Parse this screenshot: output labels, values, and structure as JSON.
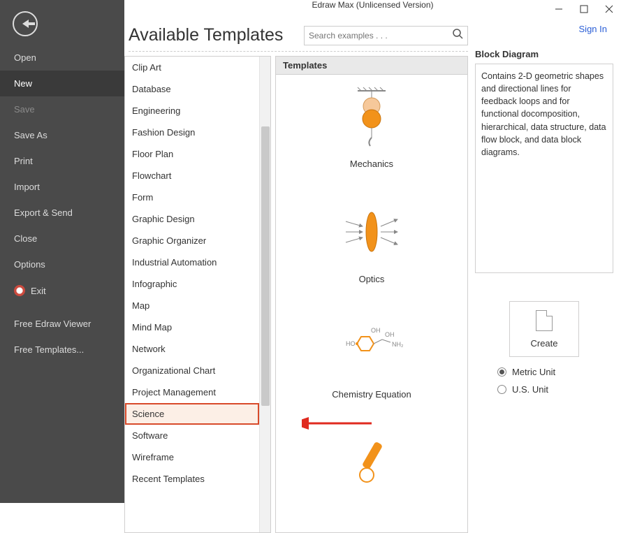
{
  "window": {
    "title": "Edraw Max (Unlicensed Version)"
  },
  "signin": "Sign In",
  "sidebar": {
    "items": [
      {
        "label": "Open",
        "state": "normal"
      },
      {
        "label": "New",
        "state": "active"
      },
      {
        "label": "Save",
        "state": "disabled"
      },
      {
        "label": "Save As",
        "state": "normal"
      },
      {
        "label": "Print",
        "state": "normal"
      },
      {
        "label": "Import",
        "state": "normal"
      },
      {
        "label": "Export & Send",
        "state": "normal"
      },
      {
        "label": "Close",
        "state": "normal"
      },
      {
        "label": "Options",
        "state": "normal"
      }
    ],
    "exit": "Exit",
    "extra": [
      "Free Edraw Viewer",
      "Free Templates..."
    ]
  },
  "page": {
    "title": "Available Templates",
    "search_placeholder": "Search examples . . ."
  },
  "categories": [
    "Clip Art",
    "Database",
    "Engineering",
    "Fashion Design",
    "Floor Plan",
    "Flowchart",
    "Form",
    "Graphic Design",
    "Graphic Organizer",
    "Industrial Automation",
    "Infographic",
    "Map",
    "Mind Map",
    "Network",
    "Organizational Chart",
    "Project Management",
    "Science",
    "Software",
    "Wireframe",
    "Recent Templates"
  ],
  "selected_category": "Science",
  "templates_header": "Templates",
  "templates": [
    {
      "label": "Mechanics"
    },
    {
      "label": "Optics"
    },
    {
      "label": "Chemistry Equation"
    }
  ],
  "right": {
    "title": "Block Diagram",
    "description": "Contains 2-D geometric shapes and directional lines for feedback loops and for functional docomposition, hierarchical, data structure, data flow block, and data block diagrams.",
    "create": "Create",
    "units": {
      "metric": "Metric Unit",
      "us": "U.S. Unit",
      "selected": "metric"
    }
  }
}
